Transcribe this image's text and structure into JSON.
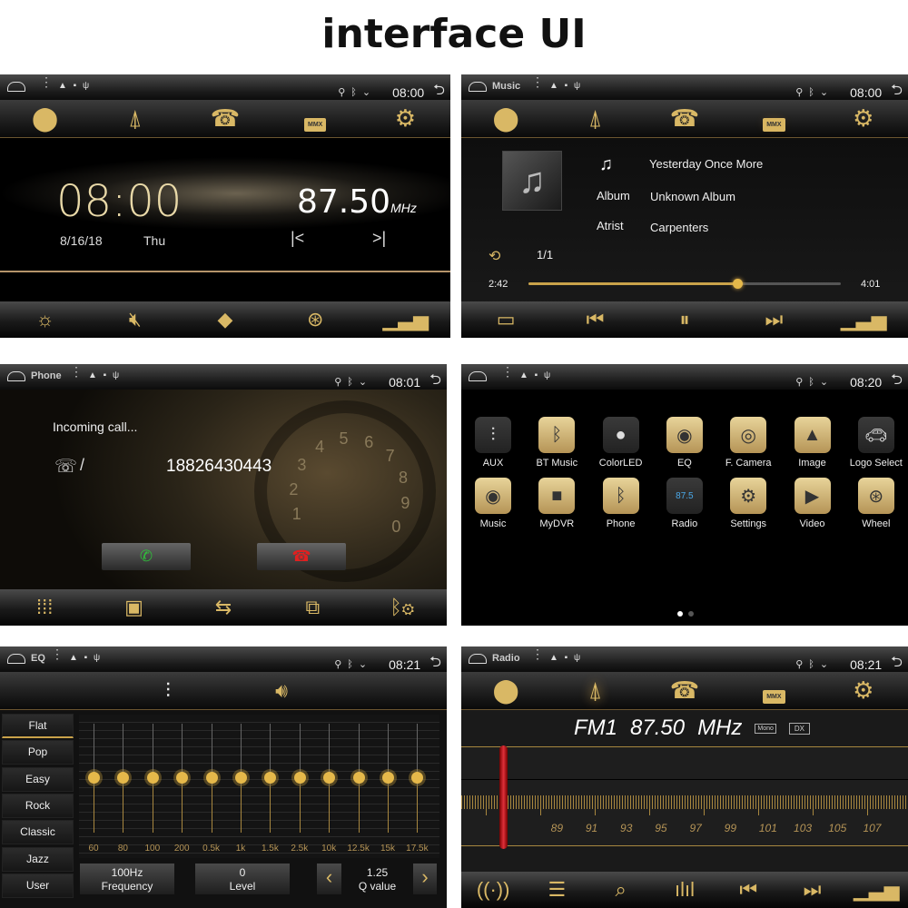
{
  "page_title": "interface UI",
  "colors": {
    "accent_gold": "#d9b865",
    "needle_red": "#c0101a",
    "background": "#000000"
  },
  "home_screen": {
    "status": {
      "time": "08:00",
      "notification_icons": [
        "warning-icon"
      ],
      "right_icons": [
        "location-icon",
        "bluetooth-icon",
        "wifi-icon"
      ]
    },
    "nav_icons": [
      "navigation-icon",
      "radio-tower-icon",
      "phone-icon",
      "mmx-folder-icon",
      "settings-icon"
    ],
    "mmx_label": "MMX",
    "clock": "08:00",
    "date": "8/16/18",
    "weekday": "Thu",
    "frequency": "87.50",
    "frequency_unit": "MHz",
    "bottom_icons": [
      "brightness-icon",
      "mute-icon",
      "apps-icon",
      "steering-wheel-icon",
      "equalizer-icon"
    ]
  },
  "music_screen": {
    "status": {
      "title": "Music",
      "time": "08:00"
    },
    "song_title": "Yesterday Once More",
    "album_label": "Album",
    "album": "Unknown Album",
    "artist_label": "Atrist",
    "artist": "Carpenters",
    "track_count": "1/1",
    "elapsed": "2:42",
    "duration": "4:01",
    "progress": 0.67,
    "bottom_icons": [
      "folder-icon",
      "previous-icon",
      "pause-icon",
      "next-icon",
      "equalizer-icon"
    ]
  },
  "phone_screen": {
    "status": {
      "title": "Phone",
      "time": "08:01"
    },
    "incoming_label": "Incoming call...",
    "separator": "/",
    "number": "18826430443",
    "rotary_digits": [
      "1",
      "2",
      "3",
      "4",
      "5",
      "6",
      "7",
      "8",
      "9",
      "0"
    ],
    "bottom_icons": [
      "dialpad-icon",
      "contacts-icon",
      "call-log-icon",
      "link-icon",
      "bluetooth-settings-icon"
    ]
  },
  "apps_screen": {
    "status": {
      "time": "08:20"
    },
    "apps": [
      {
        "label": "AUX",
        "icon": "aux-icon"
      },
      {
        "label": "BT Music",
        "icon": "bt-music-icon"
      },
      {
        "label": "ColorLED",
        "icon": "bulb-icon"
      },
      {
        "label": "EQ",
        "icon": "eq-icon"
      },
      {
        "label": "F. Camera",
        "icon": "camera-icon"
      },
      {
        "label": "Image",
        "icon": "image-icon"
      },
      {
        "label": "Logo Select",
        "icon": "car-icon"
      },
      {
        "label": "Music",
        "icon": "music-disc-icon"
      },
      {
        "label": "MyDVR",
        "icon": "dvr-icon"
      },
      {
        "label": "Phone",
        "icon": "bluetooth-phone-icon"
      },
      {
        "label": "Radio",
        "icon": "radio-icon"
      },
      {
        "label": "Settings",
        "icon": "settings-icon"
      },
      {
        "label": "Video",
        "icon": "video-icon"
      },
      {
        "label": "Wheel",
        "icon": "steering-wheel-icon"
      }
    ],
    "radio_tile_text": "87.5",
    "page_count": 2,
    "current_page": 1
  },
  "eq_screen": {
    "status": {
      "title": "EQ",
      "time": "08:21"
    },
    "tabs": [
      "sliders-icon",
      "speaker-icon"
    ],
    "presets": [
      "Flat",
      "Pop",
      "Easy",
      "Rock",
      "Classic",
      "Jazz",
      "User"
    ],
    "selected_preset": "Flat",
    "bands": [
      "60",
      "80",
      "100",
      "200",
      "0.5k",
      "1k",
      "1.5k",
      "2.5k",
      "10k",
      "12.5k",
      "15k",
      "17.5k"
    ],
    "band_levels": [
      0,
      0,
      0,
      0,
      0,
      0,
      0,
      0,
      0,
      0,
      0,
      0
    ],
    "frequency_value": "100Hz",
    "frequency_label": "Frequency",
    "level_value": "0",
    "level_label": "Level",
    "q_value": "1.25",
    "q_label": "Q value"
  },
  "radio_screen": {
    "status": {
      "title": "Radio",
      "time": "08:21"
    },
    "band": "FM1",
    "frequency": "87.50",
    "unit": "MHz",
    "mono_label": "Mono",
    "dx_label": "DX",
    "scale_labels": [
      "89",
      "91",
      "93",
      "95",
      "97",
      "99",
      "101",
      "103",
      "105",
      "107"
    ],
    "tuned_mhz": 87.5,
    "bottom_icons": [
      "signal-icon",
      "list-icon",
      "search-icon",
      "spectrum-icon",
      "previous-icon",
      "next-icon",
      "equalizer-icon"
    ]
  }
}
